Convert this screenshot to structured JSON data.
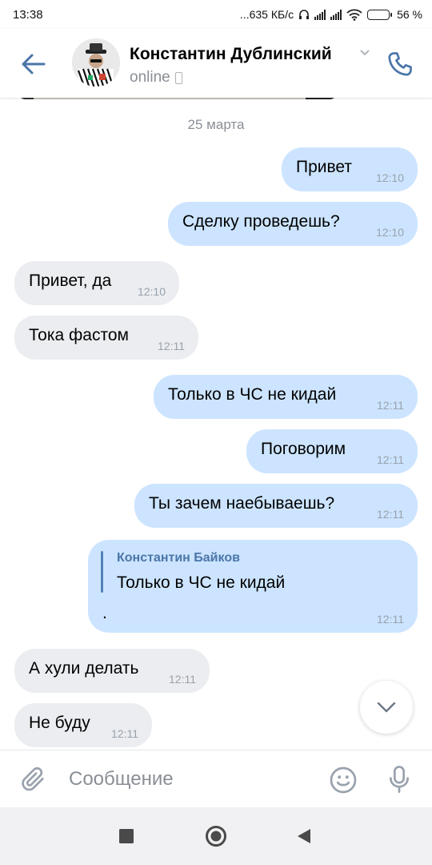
{
  "status_bar": {
    "time": "13:38",
    "network_speed": "...635 КБ/с",
    "battery_percent": "56 %",
    "battery_level": 0.56,
    "icons": [
      "headphones-icon",
      "signal-icon",
      "signal-icon",
      "wifi-icon",
      "battery-icon"
    ]
  },
  "header": {
    "contact_name": "Константин Дублинский",
    "status": "online",
    "icons": [
      "back-arrow-icon",
      "chevron-down-icon",
      "mobile-phone-icon",
      "call-icon"
    ]
  },
  "chat": {
    "date_separator": "25 марта",
    "messages": [
      {
        "direction": "out",
        "text": "Привет",
        "time": "12:10"
      },
      {
        "direction": "out",
        "text": "Сделку проведешь?",
        "time": "12:10"
      },
      {
        "direction": "in",
        "text": "Привет, да",
        "time": "12:10"
      },
      {
        "direction": "in",
        "text": "Тока фастом",
        "time": "12:11"
      },
      {
        "direction": "out",
        "text": "Только в ЧС не кидай",
        "time": "12:11"
      },
      {
        "direction": "out",
        "text": "Поговорим",
        "time": "12:11"
      },
      {
        "direction": "out",
        "text": "Ты зачем наебываешь?",
        "time": "12:11"
      },
      {
        "direction": "out",
        "reply_author": "Константин Байков",
        "reply_text": "Только в ЧС не кидай",
        "text": ".",
        "time": "12:11"
      },
      {
        "direction": "in",
        "text": "А хули делать",
        "time": "12:11"
      },
      {
        "direction": "in",
        "text": "Не буду",
        "time": "12:11"
      }
    ],
    "scroll_down_icon": "chevron-down-icon"
  },
  "composer": {
    "placeholder": "Сообщение",
    "value": "",
    "icons": [
      "paperclip-icon",
      "emoji-icon",
      "microphone-icon"
    ]
  },
  "nav_bar": {
    "icons": [
      "recents-square-icon",
      "home-circle-icon",
      "back-triangle-icon"
    ]
  },
  "colors": {
    "accent": "#4a76a8",
    "outgoing_bubble": "#cce4ff",
    "incoming_bubble": "#ebedf0",
    "secondary_text": "#8a8f96"
  }
}
